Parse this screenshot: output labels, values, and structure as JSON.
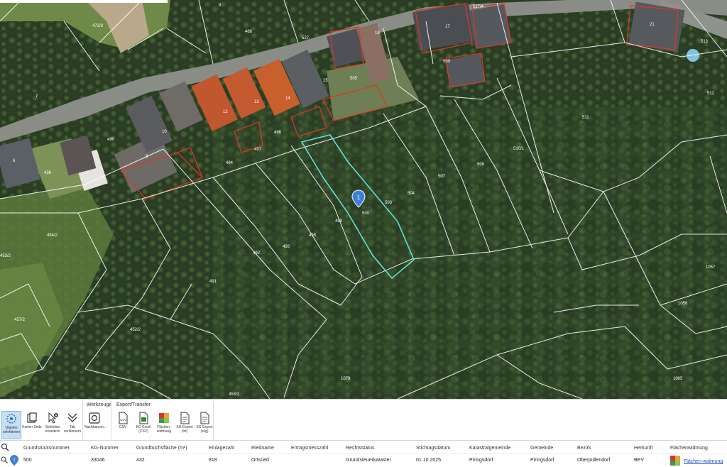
{
  "map": {
    "marker_number": "1",
    "parcel_labels": [
      {
        "id": "p-468",
        "text": "468"
      },
      {
        "id": "p-472-3",
        "text": "472/3"
      },
      {
        "id": "p-9a",
        "text": "9"
      },
      {
        "id": "p-7",
        "text": "7"
      },
      {
        "id": "p-527",
        "text": "527"
      },
      {
        "id": "p-517-4",
        "text": "517/4"
      },
      {
        "id": "p-21",
        "text": "21"
      },
      {
        "id": "p-513",
        "text": "513"
      },
      {
        "id": "p-512",
        "text": "512"
      },
      {
        "id": "p-511",
        "text": "511"
      },
      {
        "id": "p-510-1",
        "text": "510/1"
      },
      {
        "id": "p-508",
        "text": "508"
      },
      {
        "id": "p-507",
        "text": "507"
      },
      {
        "id": "p-504",
        "text": "504"
      },
      {
        "id": "p-503",
        "text": "503"
      },
      {
        "id": "p-505",
        "text": "505"
      },
      {
        "id": "p-509",
        "text": "509"
      },
      {
        "id": "p-500",
        "text": "500"
      },
      {
        "id": "p-499",
        "text": "499"
      },
      {
        "id": "p-498",
        "text": "498"
      },
      {
        "id": "p-497",
        "text": "497"
      },
      {
        "id": "p-496",
        "text": "496"
      },
      {
        "id": "p-494",
        "text": "494"
      },
      {
        "id": "p-493",
        "text": "493"
      },
      {
        "id": "p-492",
        "text": "492"
      },
      {
        "id": "p-491",
        "text": "491"
      },
      {
        "id": "p-490",
        "text": "490"
      },
      {
        "id": "p-436",
        "text": "436"
      },
      {
        "id": "p-454-2",
        "text": "454/2"
      },
      {
        "id": "p-457-2",
        "text": "457/2"
      },
      {
        "id": "p-452",
        "text": "452/2"
      },
      {
        "id": "p-453-1",
        "text": "453/1"
      },
      {
        "id": "p-453-2",
        "text": "453/2"
      },
      {
        "id": "p-1079",
        "text": "1079"
      },
      {
        "id": "p-1056",
        "text": "1056"
      },
      {
        "id": "p-1057",
        "text": "1057"
      },
      {
        "id": "p-1065",
        "text": "1065"
      },
      {
        "id": "p-17",
        "text": "17"
      },
      {
        "id": "p-18",
        "text": "18"
      },
      {
        "id": "p-15",
        "text": "15"
      },
      {
        "id": "p-14",
        "text": "14"
      },
      {
        "id": "p-13",
        "text": "13"
      },
      {
        "id": "p-12",
        "text": "12"
      },
      {
        "id": "p-10",
        "text": "10"
      },
      {
        "id": "p-8",
        "text": "8"
      },
      {
        "id": "p-6",
        "text": "6"
      }
    ]
  },
  "ribbon": {
    "groups": {
      "werkzeuge": "Werkzeuge",
      "export": "Export/Transfer"
    },
    "tools": {
      "objekte_selektieren": "Objekte selektieren",
      "karten_seite": "Karten Seite",
      "selektion_erweitern": "Selektion erweitern",
      "tab_verkleinern": "Tab verkleinern",
      "nachbarschaft": "Nachbarsch...",
      "csv": "CSV",
      "kg_excel": "KG Excel (CSV)",
      "flaechenwidmung": "Flächen-widmung",
      "kg_export_txt": "KG Export (txt)",
      "kg_export_svg": "KG Export (svg)"
    }
  },
  "table": {
    "columns": [
      "Grundstücksnummer",
      "KG-Nummer",
      "Grundbuchsfläche (m²)",
      "Einlagezahl",
      "Riedname",
      "Ertragsmesszahl",
      "Rechtsstatus",
      "Stichtagsdatum",
      "Katastralgemeinde",
      "Gemeinde",
      "Bezirk",
      "Herkunft",
      "Flächenwidmung"
    ],
    "row": {
      "marker": "1",
      "grundstuecksnummer": "500",
      "kg_nummer": "33046",
      "flaeche": "432",
      "einlagezahl": "818",
      "riedname": "Ortsried",
      "ertragsmesszahl": "",
      "rechtsstatus": "Grundsteuerkataster",
      "stichtagsdatum": "01.10.2025",
      "katastralgemeinde": "Piringsdorf",
      "gemeinde": "Piringsdorf",
      "bezirk": "Oberpullendorf",
      "herkunft": "BEV",
      "flaechenwidmung_link": "Flächen-widmung"
    }
  },
  "colors": {
    "parcel_line": "#ffffff",
    "selected_parcel": "#62e0d6",
    "building_outline": "#e0342a",
    "marker": "#3f7fd8",
    "link": "#1a56b8"
  }
}
